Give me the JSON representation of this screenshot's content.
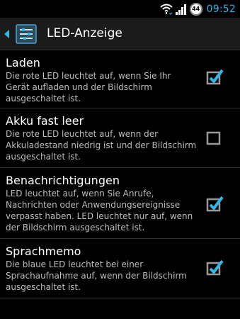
{
  "status_bar": {
    "icons": [
      "wifi-icon",
      "signal-icon",
      "battery-icon"
    ],
    "battery_level": "44",
    "time": "09:52"
  },
  "action_bar": {
    "title": "LED-Anzeige",
    "back_icon": "chevron-left-icon",
    "app_icon": "settings-app-icon"
  },
  "preferences": [
    {
      "title": "Laden",
      "summary": "Die rote LED leuchtet auf, wenn Sie Ihr Gerät aufladen und der Bildschirm ausgeschaltet ist.",
      "checked": true
    },
    {
      "title": "Akku fast leer",
      "summary": "Die rote LED leuchtet auf, wenn der Akkuladestand niedrig ist und der Bildschirm ausgeschaltet ist.",
      "checked": false
    },
    {
      "title": "Benachrichtigungen",
      "summary": "LED leuchtet auf, wenn Sie Anrufe, Nachrichten oder Anwendungsereignisse verpasst haben. LED leuchtet nur auf, wenn der Bildschirm ausgeschaltet ist.",
      "checked": true
    },
    {
      "title": "Sprachmemo",
      "summary": "Die blaue LED leuchtet bei einer Sprachaufnahme auf, wenn der Bildschirm ausgeschaltet ist.",
      "checked": true
    }
  ],
  "colors": {
    "accent": "#33b5e5",
    "clock": "#2ab2ee",
    "background": "#000000",
    "action_bar": "#1b1b1b"
  }
}
